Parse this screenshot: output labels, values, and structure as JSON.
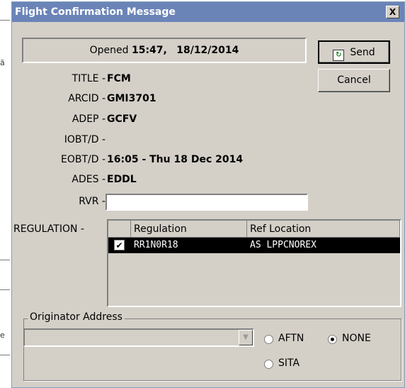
{
  "window": {
    "title": "Flight Confirmation Message",
    "close_glyph": "X"
  },
  "opened": {
    "prefix": "Opened",
    "time": "15:47,",
    "date": "18/12/2014"
  },
  "buttons": {
    "send": "Send",
    "cancel": "Cancel",
    "send_icon": "refresh-document-icon"
  },
  "fields": [
    {
      "label": "TITLE -",
      "value": "FCM"
    },
    {
      "label": "ARCID -",
      "value": "GMI3701"
    },
    {
      "label": "ADEP -",
      "value": "GCFV"
    },
    {
      "label": "IOBT/D -",
      "value": ""
    },
    {
      "label": "EOBT/D -",
      "value": "16:05 - Thu 18 Dec 2014"
    },
    {
      "label": "ADES -",
      "value": "EDDL"
    }
  ],
  "rvr": {
    "label": "RVR -",
    "value": ""
  },
  "regulation": {
    "label": "REGULATION -",
    "columns": [
      "Regulation",
      "Ref Location"
    ],
    "rows": [
      {
        "checked": true,
        "regulation": "RR1N0R18",
        "ref_location": "AS LPPCNOREX"
      }
    ]
  },
  "originator": {
    "legend": "Originator Address",
    "value": "",
    "options": [
      {
        "label": "AFTN",
        "selected": false
      },
      {
        "label": "NONE",
        "selected": true
      },
      {
        "label": "SITA",
        "selected": false
      }
    ]
  },
  "colors": {
    "titlebar": "#6b84b8",
    "dialog_bg": "#d4d0c8",
    "selected_row": "#000000"
  }
}
